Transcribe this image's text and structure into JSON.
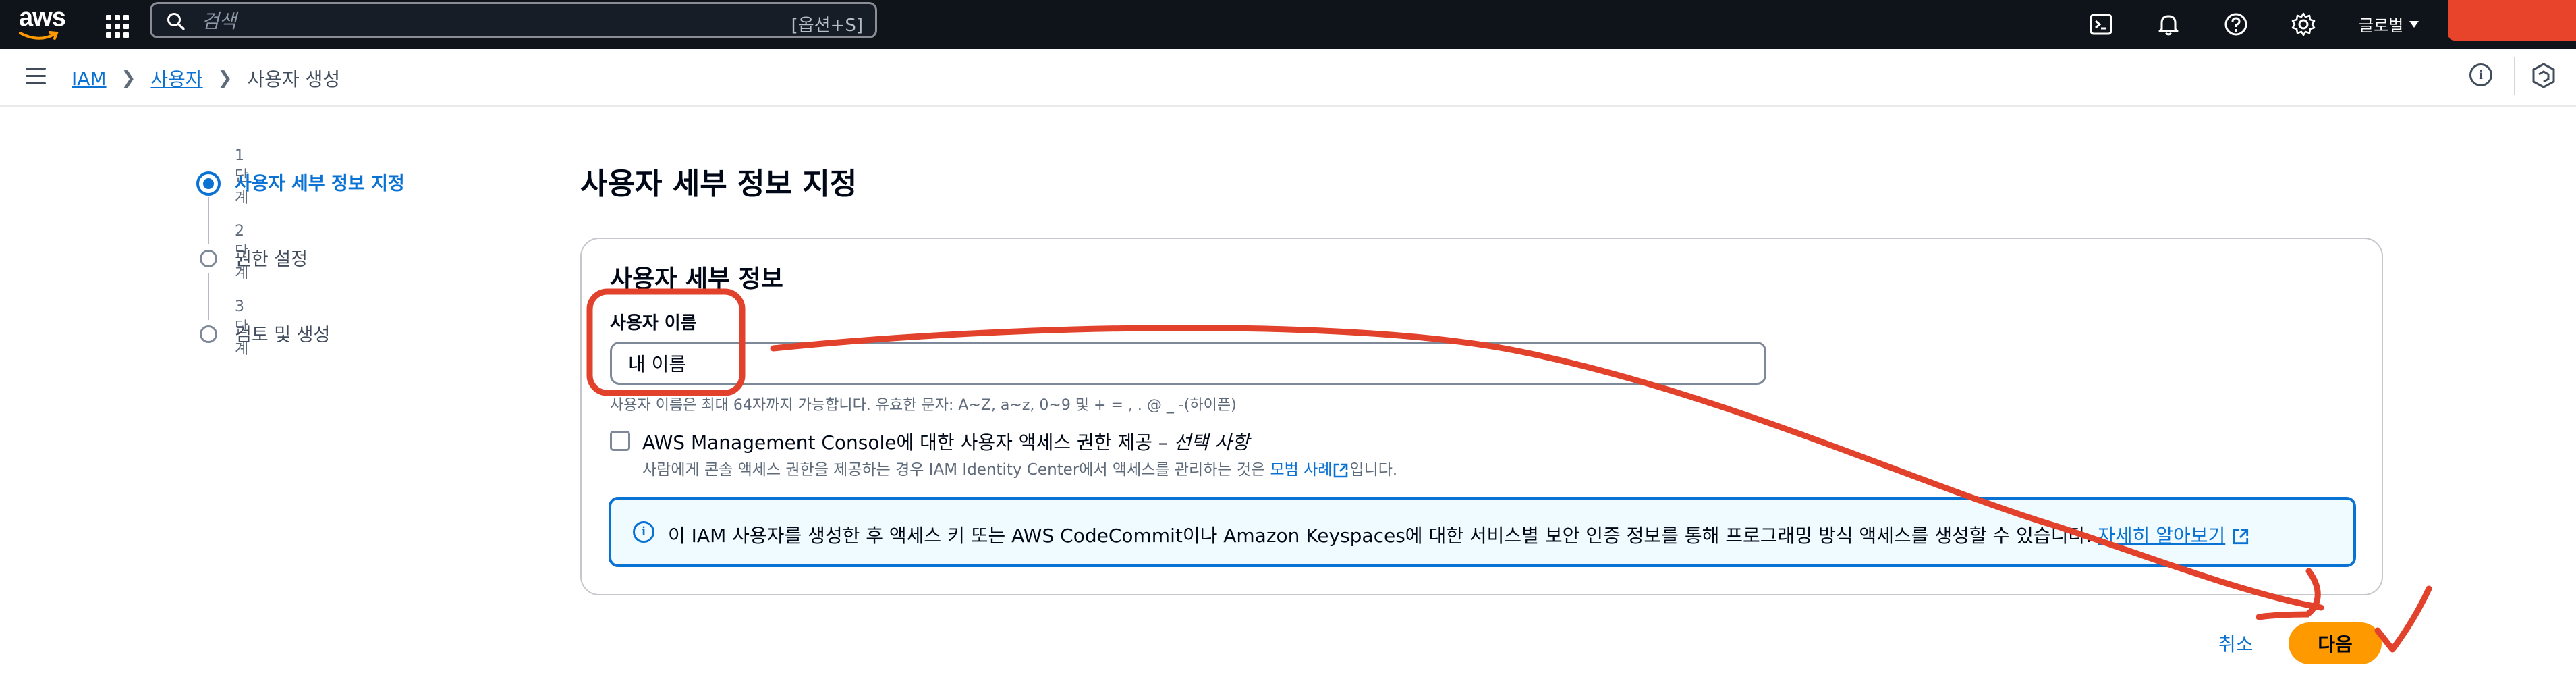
{
  "topnav": {
    "logo_text": "aws",
    "search_placeholder": "검색",
    "search_shortcut": "[옵션+S]",
    "region_label": "글로벌",
    "icons": [
      "apps-grid-icon",
      "search-icon",
      "cloudshell-icon",
      "bell-icon",
      "help-icon",
      "gear-icon",
      "caret-down-icon"
    ],
    "account_color": "#e8432b"
  },
  "breadcrumb": {
    "items": [
      "IAM",
      "사용자",
      "사용자 생성"
    ]
  },
  "steps": [
    {
      "number": "1단계",
      "label": "사용자 세부 정보 지정",
      "state": "active"
    },
    {
      "number": "2단계",
      "label": "권한 설정",
      "state": "inactive"
    },
    {
      "number": "3단계",
      "label": "검토 및 생성",
      "state": "inactive"
    }
  ],
  "main": {
    "page_title": "사용자 세부 정보 지정",
    "card_title": "사용자 세부 정보",
    "username_label": "사용자 이름",
    "username_value": "내 이름",
    "username_hint": "사용자 이름은 최대 64자까지 가능합니다. 유효한 문자: A~Z, a~z, 0~9 및 + = , . @ _ -(하이픈)",
    "console_access": {
      "checked": false,
      "label": "AWS Management Console에 대한 사용자 액세스 권한 제공 – ",
      "label_optional": "선택 사항",
      "desc_prefix": "사람에게 콘솔 액세스 권한을 제공하는 경우 IAM Identity Center에서 액세스를 관리하는 것은 ",
      "desc_link": "모범 사례",
      "desc_suffix": "입니다."
    },
    "info_alert": {
      "message": "이 IAM 사용자를 생성한 후 액세스 키 또는 AWS CodeCommit이나 Amazon Keyspaces에 대한 서비스별 보안 인증 정보를 통해 프로그래밍 방식 액세스를 생성할 수 있습니다. ",
      "link": "자세히 알아보기"
    }
  },
  "actions": {
    "cancel": "취소",
    "next": "다음"
  },
  "colors": {
    "accent": "#0972d3",
    "primary_button": "#ff9900",
    "annotation": "#e2412b",
    "topnav_bg": "#0f141a"
  }
}
